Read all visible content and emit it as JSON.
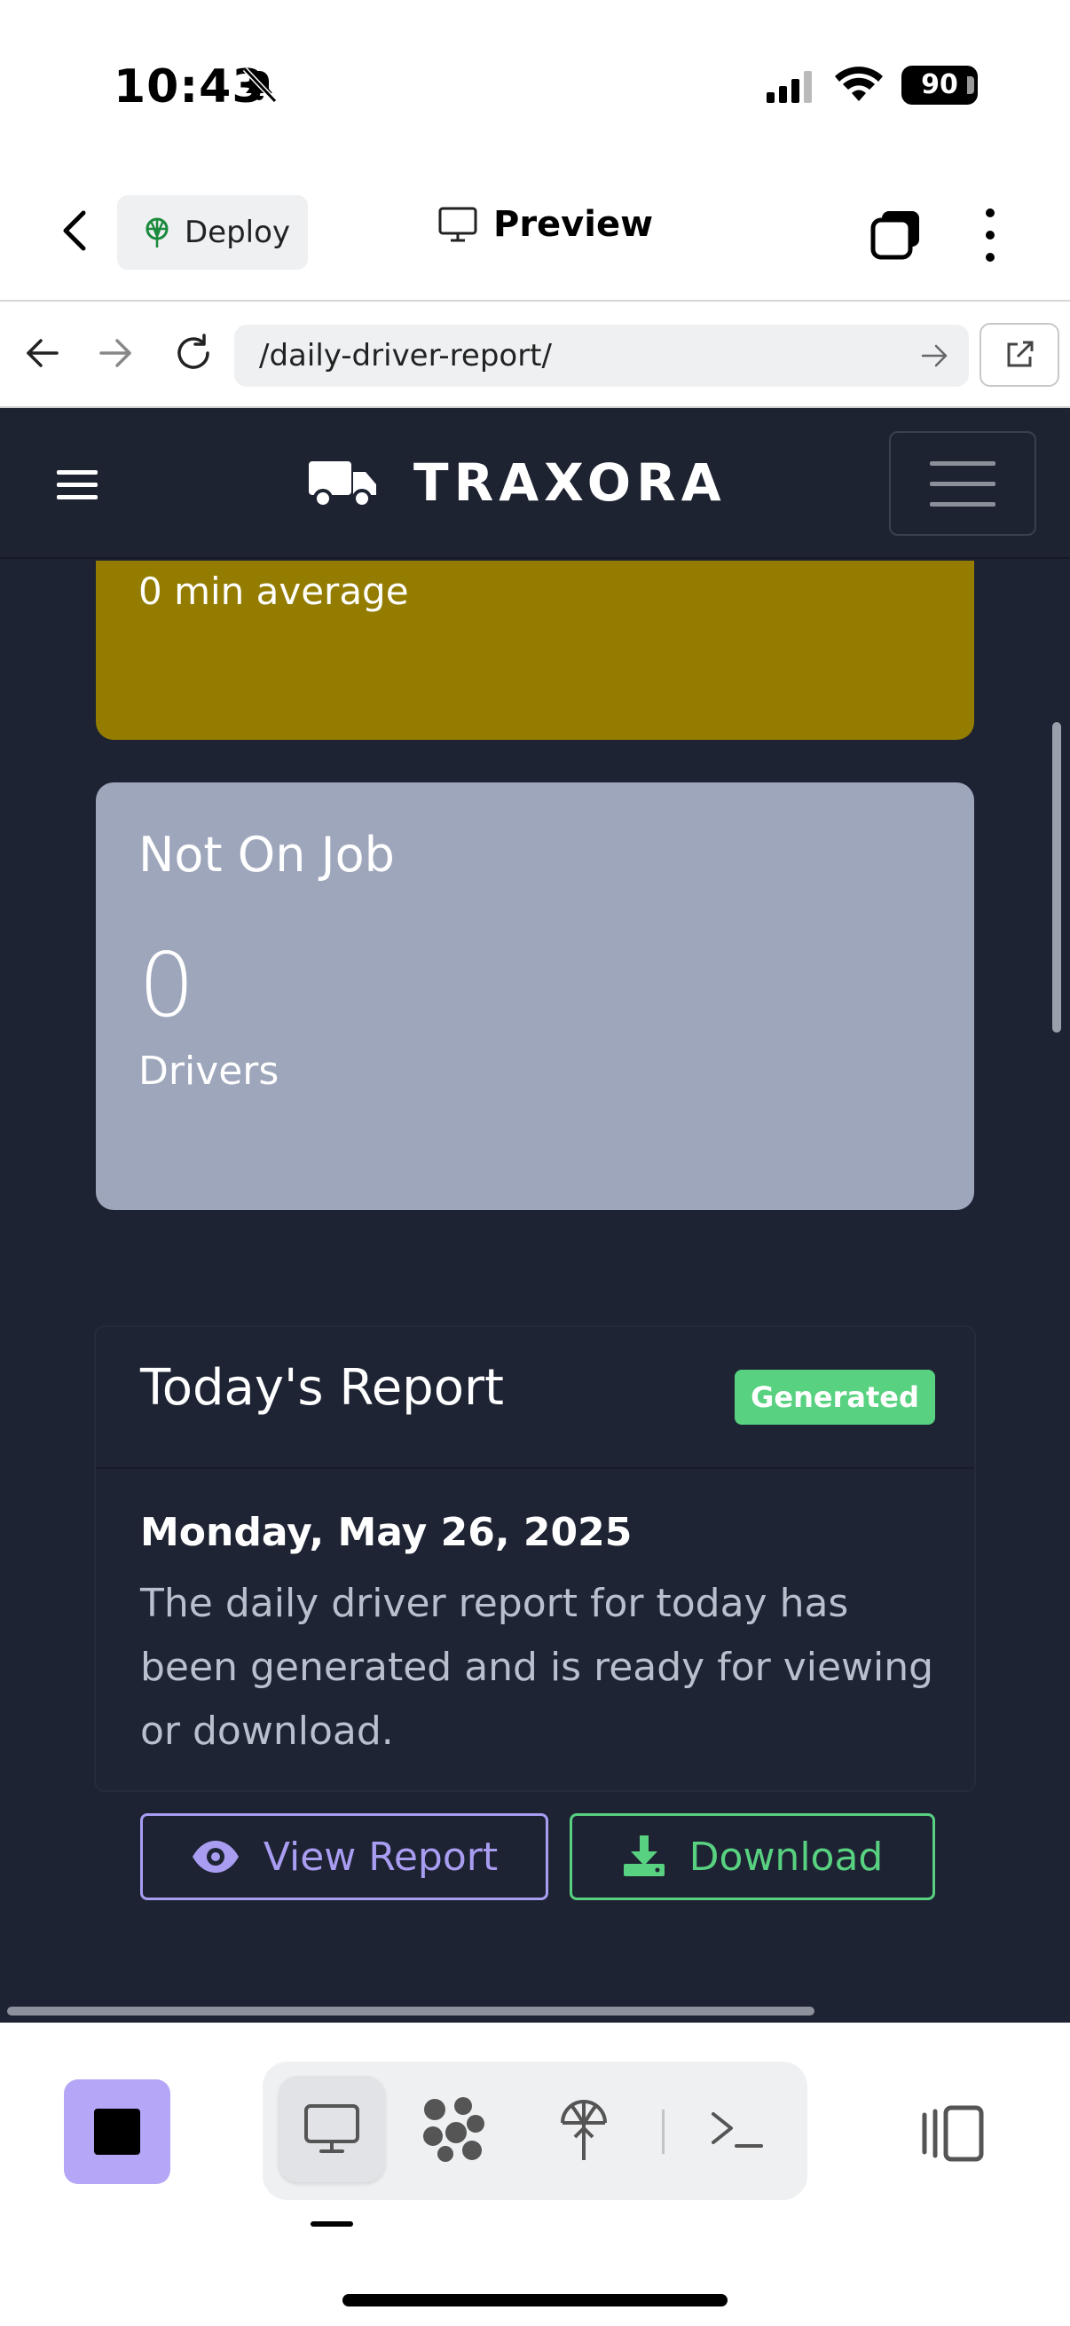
{
  "status_bar": {
    "time": "10:43",
    "battery": "90",
    "icons": [
      "bell-slash-icon",
      "signal-icon",
      "wifi-icon",
      "battery-icon"
    ]
  },
  "app_bar": {
    "deploy_label": "Deploy",
    "preview_label": "Preview",
    "icons": [
      "chevron-left-icon",
      "deploy-icon",
      "monitor-icon",
      "tabs-icon",
      "kebab-icon"
    ]
  },
  "browser": {
    "url": "/daily-driver-report/",
    "icons": [
      "arrow-left-icon",
      "arrow-right-icon",
      "reload-icon",
      "go-arrow-icon",
      "open-external-icon"
    ]
  },
  "site_nav": {
    "brand": "TRAXORA",
    "icons": [
      "hamburger-icon",
      "truck-icon",
      "navbar-toggler-icon"
    ]
  },
  "cards": {
    "wait": {
      "subtitle": "0 min average",
      "color": "#937c00"
    },
    "not_on_job": {
      "title": "Not On Job",
      "value": "0",
      "label": "Drivers",
      "color": "#9ea6bb"
    }
  },
  "report": {
    "title": "Today's Report",
    "badge": "Generated",
    "badge_color": "#58d180",
    "date": "Monday, May 26, 2025",
    "description": "The daily driver report for today has been generated and is ready for viewing or download.",
    "view_label": "View Report",
    "download_label": "Download",
    "view_color": "#a99df2",
    "download_color": "#58d180"
  },
  "toolbar": {
    "accent": "#b5a6f7",
    "icons": [
      "stop-icon",
      "monitor-icon",
      "nodes-icon",
      "deploy-icon",
      "terminal-icon",
      "panels-icon"
    ]
  },
  "colors": {
    "page_bg": "#1d2333",
    "nav_bg": "#1e2332"
  }
}
